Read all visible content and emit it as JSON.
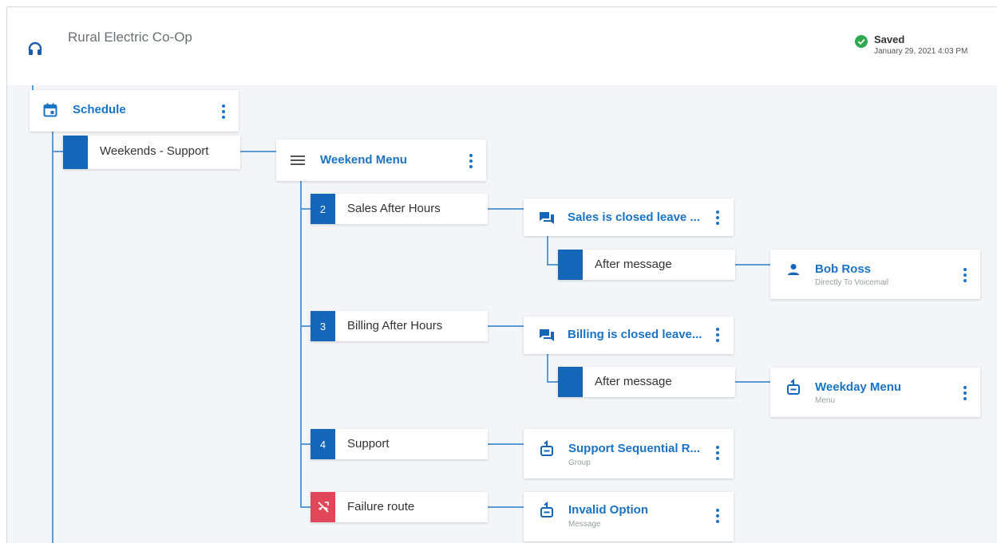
{
  "header": {
    "app_icon": "headset-icon",
    "title": "Rural Electric Co-Op",
    "status": {
      "icon": "check-circle-icon",
      "label": "Saved",
      "timestamp": "January 29, 2021 4:03 PM"
    }
  },
  "colors": {
    "accent": "#1a73c4",
    "badge": "#1565b8",
    "failure": "#e0485a",
    "connector": "#5b9bd5",
    "canvas": "#f3f5f9",
    "saved": "#2fa84f"
  },
  "flow": {
    "schedule": {
      "icon": "calendar-icon",
      "title": "Schedule"
    },
    "weekends_support": {
      "label": "Weekends - Support"
    },
    "weekend_menu": {
      "icon": "menu-lines-icon",
      "title": "Weekend Menu"
    },
    "options": [
      {
        "badge": "2",
        "label": "Sales After Hours"
      },
      {
        "badge": "3",
        "label": "Billing After Hours"
      },
      {
        "badge": "4",
        "label": "Support"
      },
      {
        "badge": "",
        "badge_icon": "no-phone-icon",
        "label": "Failure route"
      }
    ],
    "sales_message": {
      "icon": "chat-icon",
      "title": "Sales is closed leave ..."
    },
    "billing_message": {
      "icon": "chat-icon",
      "title": "Billing is closed leave..."
    },
    "after_message_1": {
      "label": "After message"
    },
    "after_message_2": {
      "label": "After message"
    },
    "bob_ross": {
      "icon": "person-icon",
      "title": "Bob Ross",
      "subtitle": "Directly To Voicemail"
    },
    "weekday_menu": {
      "icon": "route-icon",
      "title": "Weekday Menu",
      "subtitle": "Menu"
    },
    "support_group": {
      "icon": "route-icon",
      "title": "Support Sequential R...",
      "subtitle": "Group"
    },
    "invalid_option": {
      "icon": "route-icon",
      "title": "Invalid Option",
      "subtitle": "Message"
    }
  }
}
